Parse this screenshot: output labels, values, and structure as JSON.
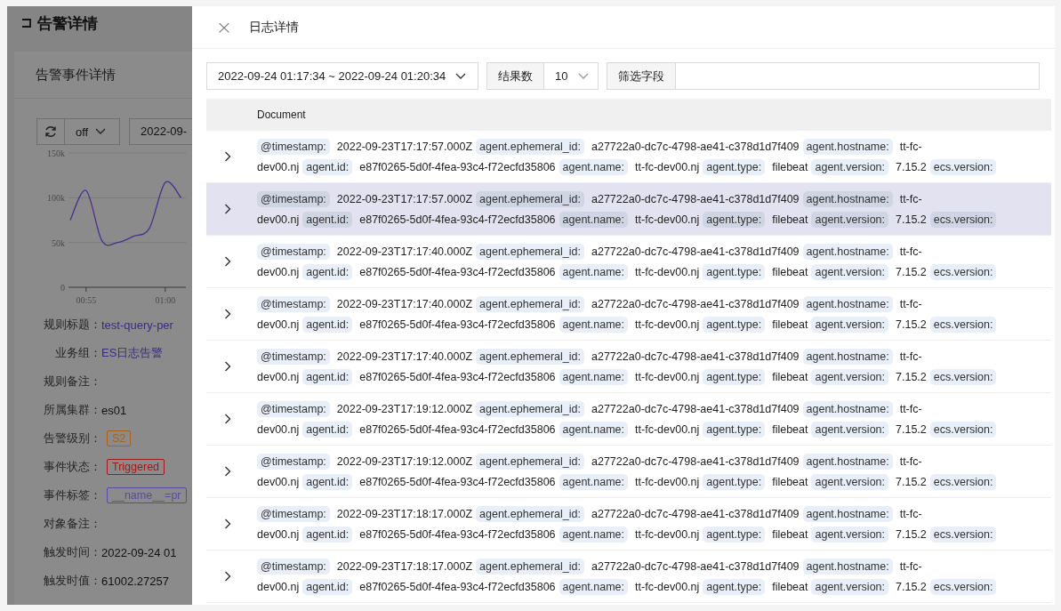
{
  "page": {
    "title": "告警详情",
    "card_title": "告警事件详情",
    "refresh_select": "off",
    "date_field": "2022-09-",
    "chart": {
      "chart_data": {
        "type": "line",
        "categories": [
          null,
          "00:55",
          null,
          null,
          null,
          null,
          "01:00",
          null
        ],
        "yticks": [
          {
            "value": 0,
            "label": "0"
          },
          {
            "value": 50000,
            "label": "50k"
          },
          {
            "value": 100000,
            "label": "100k"
          },
          {
            "value": 150000,
            "label": "150k"
          }
        ],
        "ylim": [
          0,
          150000
        ],
        "series": [
          {
            "color": "#4b2f8f",
            "values": [
              75000,
              108000,
              52000,
              50000,
              57000,
              66000,
              117000,
              100000
            ]
          }
        ]
      }
    },
    "details": [
      {
        "label": "规则标题：",
        "kind": "link",
        "value": "test-query-per"
      },
      {
        "label": "业务组：",
        "kind": "link",
        "value": "ES日志告警"
      },
      {
        "label": "规则备注：",
        "kind": "empty"
      },
      {
        "label": "所属集群：",
        "kind": "text",
        "value": "es01"
      },
      {
        "label": "告警级别：",
        "kind": "tag",
        "value": "S2",
        "color": "#a8621c"
      },
      {
        "label": "事件状态：",
        "kind": "tag",
        "value": "Triggered",
        "color": "#a01a1a"
      },
      {
        "label": "事件标签：",
        "kind": "tag",
        "value": "__name__=pr",
        "color": "#5a4aa0"
      },
      {
        "label": "对象备注：",
        "kind": "empty"
      },
      {
        "label": "触发时间：",
        "kind": "text",
        "value": "2022-09-24 01"
      },
      {
        "label": "触发时值：",
        "kind": "text",
        "value": "61002.27257"
      }
    ]
  },
  "drawer": {
    "title": "日志详情",
    "close": "×",
    "time_range": "2022-09-24 01:17:34 ~ 2022-09-24 01:20:34",
    "result_label": "结果数",
    "result_count": "10",
    "filter_label": "筛选字段",
    "table": {
      "columns": [
        "Document"
      ],
      "rows": [
        {
          "selected": false,
          "lines": [
            [
              {
                "key": "@timestamp:",
                "value": "2022-09-23T17:17:57.000Z"
              },
              {
                "key": "agent.ephemeral_id:",
                "value": "a27722a0-dc7c-4798-ae41-c378d1d7f409"
              },
              {
                "key": "agent.hostname:",
                "value": "tt-fc-"
              }
            ],
            [
              {
                "value": "dev00.nj"
              },
              {
                "key": "agent.id:",
                "value": "e87f0265-5d0f-4fea-93c4-f72ecfd35806"
              },
              {
                "key": "agent.name:",
                "value": "tt-fc-dev00.nj"
              },
              {
                "key": "agent.type:",
                "value": "filebeat"
              },
              {
                "key": "agent.version:",
                "value": "7.15.2"
              },
              {
                "key": "ecs.version:"
              }
            ]
          ]
        },
        {
          "selected": true,
          "lines": [
            [
              {
                "key": "@timestamp:",
                "value": "2022-09-23T17:17:57.000Z"
              },
              {
                "key": "agent.ephemeral_id:",
                "value": "a27722a0-dc7c-4798-ae41-c378d1d7f409"
              },
              {
                "key": "agent.hostname:",
                "value": "tt-fc-"
              }
            ],
            [
              {
                "value": "dev00.nj"
              },
              {
                "key": "agent.id:",
                "value": "e87f0265-5d0f-4fea-93c4-f72ecfd35806"
              },
              {
                "key": "agent.name:",
                "value": "tt-fc-dev00.nj"
              },
              {
                "key": "agent.type:",
                "value": "filebeat"
              },
              {
                "key": "agent.version:",
                "value": "7.15.2"
              },
              {
                "key": "ecs.version:"
              }
            ]
          ]
        },
        {
          "selected": false,
          "lines": [
            [
              {
                "key": "@timestamp:",
                "value": "2022-09-23T17:17:40.000Z"
              },
              {
                "key": "agent.ephemeral_id:",
                "value": "a27722a0-dc7c-4798-ae41-c378d1d7f409"
              },
              {
                "key": "agent.hostname:",
                "value": "tt-fc-"
              }
            ],
            [
              {
                "value": "dev00.nj"
              },
              {
                "key": "agent.id:",
                "value": "e87f0265-5d0f-4fea-93c4-f72ecfd35806"
              },
              {
                "key": "agent.name:",
                "value": "tt-fc-dev00.nj"
              },
              {
                "key": "agent.type:",
                "value": "filebeat"
              },
              {
                "key": "agent.version:",
                "value": "7.15.2"
              },
              {
                "key": "ecs.version:"
              }
            ]
          ]
        },
        {
          "selected": false,
          "lines": [
            [
              {
                "key": "@timestamp:",
                "value": "2022-09-23T17:17:40.000Z"
              },
              {
                "key": "agent.ephemeral_id:",
                "value": "a27722a0-dc7c-4798-ae41-c378d1d7f409"
              },
              {
                "key": "agent.hostname:",
                "value": "tt-fc-"
              }
            ],
            [
              {
                "value": "dev00.nj"
              },
              {
                "key": "agent.id:",
                "value": "e87f0265-5d0f-4fea-93c4-f72ecfd35806"
              },
              {
                "key": "agent.name:",
                "value": "tt-fc-dev00.nj"
              },
              {
                "key": "agent.type:",
                "value": "filebeat"
              },
              {
                "key": "agent.version:",
                "value": "7.15.2"
              },
              {
                "key": "ecs.version:"
              }
            ]
          ]
        },
        {
          "selected": false,
          "lines": [
            [
              {
                "key": "@timestamp:",
                "value": "2022-09-23T17:17:40.000Z"
              },
              {
                "key": "agent.ephemeral_id:",
                "value": "a27722a0-dc7c-4798-ae41-c378d1d7f409"
              },
              {
                "key": "agent.hostname:",
                "value": "tt-fc-"
              }
            ],
            [
              {
                "value": "dev00.nj"
              },
              {
                "key": "agent.id:",
                "value": "e87f0265-5d0f-4fea-93c4-f72ecfd35806"
              },
              {
                "key": "agent.name:",
                "value": "tt-fc-dev00.nj"
              },
              {
                "key": "agent.type:",
                "value": "filebeat"
              },
              {
                "key": "agent.version:",
                "value": "7.15.2"
              },
              {
                "key": "ecs.version:"
              }
            ]
          ]
        },
        {
          "selected": false,
          "lines": [
            [
              {
                "key": "@timestamp:",
                "value": "2022-09-23T17:19:12.000Z"
              },
              {
                "key": "agent.ephemeral_id:",
                "value": "a27722a0-dc7c-4798-ae41-c378d1d7f409"
              },
              {
                "key": "agent.hostname:",
                "value": "tt-fc-"
              }
            ],
            [
              {
                "value": "dev00.nj"
              },
              {
                "key": "agent.id:",
                "value": "e87f0265-5d0f-4fea-93c4-f72ecfd35806"
              },
              {
                "key": "agent.name:",
                "value": "tt-fc-dev00.nj"
              },
              {
                "key": "agent.type:",
                "value": "filebeat"
              },
              {
                "key": "agent.version:",
                "value": "7.15.2"
              },
              {
                "key": "ecs.version:"
              }
            ]
          ]
        },
        {
          "selected": false,
          "lines": [
            [
              {
                "key": "@timestamp:",
                "value": "2022-09-23T17:19:12.000Z"
              },
              {
                "key": "agent.ephemeral_id:",
                "value": "a27722a0-dc7c-4798-ae41-c378d1d7f409"
              },
              {
                "key": "agent.hostname:",
                "value": "tt-fc-"
              }
            ],
            [
              {
                "value": "dev00.nj"
              },
              {
                "key": "agent.id:",
                "value": "e87f0265-5d0f-4fea-93c4-f72ecfd35806"
              },
              {
                "key": "agent.name:",
                "value": "tt-fc-dev00.nj"
              },
              {
                "key": "agent.type:",
                "value": "filebeat"
              },
              {
                "key": "agent.version:",
                "value": "7.15.2"
              },
              {
                "key": "ecs.version:"
              }
            ]
          ]
        },
        {
          "selected": false,
          "lines": [
            [
              {
                "key": "@timestamp:",
                "value": "2022-09-23T17:18:17.000Z"
              },
              {
                "key": "agent.ephemeral_id:",
                "value": "a27722a0-dc7c-4798-ae41-c378d1d7f409"
              },
              {
                "key": "agent.hostname:",
                "value": "tt-fc-"
              }
            ],
            [
              {
                "value": "dev00.nj"
              },
              {
                "key": "agent.id:",
                "value": "e87f0265-5d0f-4fea-93c4-f72ecfd35806"
              },
              {
                "key": "agent.name:",
                "value": "tt-fc-dev00.nj"
              },
              {
                "key": "agent.type:",
                "value": "filebeat"
              },
              {
                "key": "agent.version:",
                "value": "7.15.2"
              },
              {
                "key": "ecs.version:"
              }
            ]
          ]
        },
        {
          "selected": false,
          "lines": [
            [
              {
                "key": "@timestamp:",
                "value": "2022-09-23T17:18:17.000Z"
              },
              {
                "key": "agent.ephemeral_id:",
                "value": "a27722a0-dc7c-4798-ae41-c378d1d7f409"
              },
              {
                "key": "agent.hostname:",
                "value": "tt-fc-"
              }
            ],
            [
              {
                "value": "dev00.nj"
              },
              {
                "key": "agent.id:",
                "value": "e87f0265-5d0f-4fea-93c4-f72ecfd35806"
              },
              {
                "key": "agent.name:",
                "value": "tt-fc-dev00.nj"
              },
              {
                "key": "agent.type:",
                "value": "filebeat"
              },
              {
                "key": "agent.version:",
                "value": "7.15.2"
              },
              {
                "key": "ecs.version:"
              }
            ]
          ]
        }
      ]
    }
  }
}
